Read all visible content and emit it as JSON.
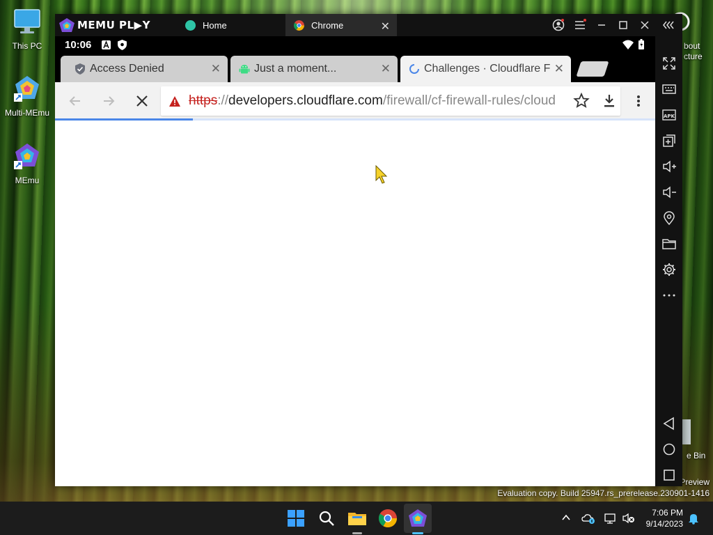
{
  "desktop": {
    "icons": [
      {
        "label": "This PC",
        "icon": "monitor-icon"
      },
      {
        "label": "Multi-MEmu",
        "icon": "multi-memu-icon"
      },
      {
        "label": "MEmu",
        "icon": "memu-icon"
      }
    ],
    "right_fragments": {
      "about_line1": "bout",
      "about_line2": "cture",
      "recycle_bin": "e Bin",
      "preview": "Preview"
    },
    "watermark": "Evaluation copy. Build 25947.rs_prerelease.230901-1416"
  },
  "memu": {
    "logo_text": "MEMU PL▶Y",
    "tabs": [
      {
        "label": "Home",
        "icon": "home-icon",
        "active": false
      },
      {
        "label": "Chrome",
        "icon": "chrome-icon",
        "active": true
      }
    ],
    "controls": [
      "account-icon",
      "menu-icon",
      "minimize-icon",
      "maximize-icon",
      "close-icon",
      "collapse-sidebar-icon"
    ]
  },
  "android": {
    "status_time": "10:06",
    "status_icons": [
      "a-notification-icon",
      "shield-notification-icon",
      "wifi-icon",
      "battery-icon"
    ]
  },
  "chrome": {
    "tabs": [
      {
        "title": "Access Denied",
        "icon": "cloudflare-shield-icon"
      },
      {
        "title": "Just a moment...",
        "icon": "android-icon"
      },
      {
        "title": "Challenges · Cloudflare F",
        "icon": "loading-spinner-icon"
      }
    ],
    "url": {
      "scheme": "https",
      "separator": "://",
      "host": "developers.cloudflare.com",
      "path": "/firewall/cf-firewall-rules/cloud"
    },
    "load_progress": 0.23
  },
  "sidebar_icons": [
    "fullscreen-icon",
    "keyboard-icon",
    "apk-icon",
    "multi-window-icon",
    "volume-up-icon",
    "volume-down-icon",
    "location-icon",
    "folder-icon",
    "settings-icon",
    "more-icon",
    "back-nav-icon",
    "home-nav-icon",
    "recents-nav-icon"
  ],
  "taskbar": {
    "apps": [
      "windows-start-icon",
      "search-icon",
      "file-explorer-icon",
      "chrome-icon",
      "memu-icon"
    ],
    "time": "7:06 PM",
    "date": "9/14/2023"
  },
  "colors": {
    "memu_chrome": "#121212",
    "url_warning": "#c5221f",
    "progress": "#4a86e8"
  }
}
